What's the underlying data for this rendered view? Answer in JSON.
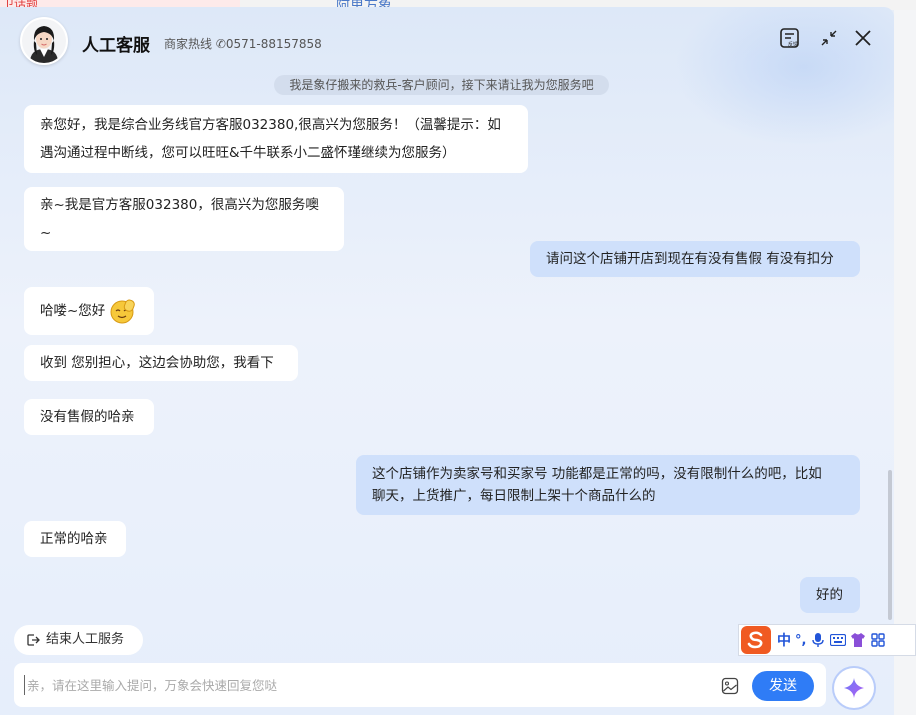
{
  "background": {
    "left_tab_text": "卫话题",
    "mid_tab_text": "阿里万象"
  },
  "header": {
    "title": "人工客服",
    "hotline": "商家热线 ✆0571-88157858",
    "feedback_badge": "反馈"
  },
  "notice": "我是象仔搬来的救兵-客户顾问，接下来请让我为您服务吧",
  "messages": [
    {
      "role": "agent",
      "text_line1": "亲您好，我是综合业务线官方客服032380,很高兴为您服务！（温馨提示：如",
      "text_line2": "遇沟通过程中断线，您可以旺旺&千牛联系小二盛怀瑾继续为您服务）"
    },
    {
      "role": "agent",
      "text": "亲~我是官方客服032380，很高兴为您服务噢~"
    },
    {
      "role": "user",
      "text": "请问这个店铺开店到现在有没有售假 有没有扣分"
    },
    {
      "role": "agent",
      "text": "哈喽~您好"
    },
    {
      "role": "agent",
      "text": "收到 您别担心，这边会协助您，我看下"
    },
    {
      "role": "agent",
      "text": "没有售假的哈亲"
    },
    {
      "role": "user",
      "text_line1": "这个店铺作为卖家号和买家号 功能都是正常的吗，没有限制什么的吧，比如",
      "text_line2": "聊天，上货推广，每日限制上架十个商品什么的"
    },
    {
      "role": "agent",
      "text": "正常的哈亲"
    },
    {
      "role": "user",
      "text": "好的"
    }
  ],
  "end_service_label": "结束人工服务",
  "input": {
    "placeholder": "亲，请在这里输入提问，万象会快速回复您哒",
    "value": ""
  },
  "send_label": "发送",
  "ime": {
    "mode_label": "中",
    "punct_label": "°,"
  },
  "colors": {
    "accent": "#2f7cf6",
    "user_bubble": "#cfe0fb",
    "agent_bubble": "#ffffff"
  }
}
